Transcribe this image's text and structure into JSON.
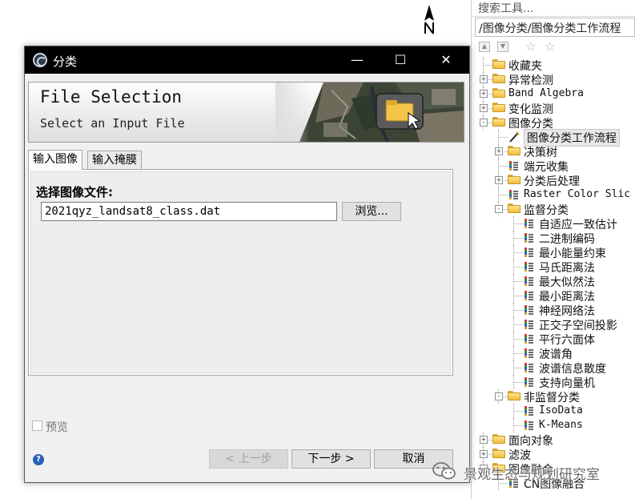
{
  "toolbox": {
    "search_placeholder": "搜索工具...",
    "path": "/图像分类/图像分类工作流程",
    "tree": [
      {
        "label": "收藏夹",
        "type": "folder",
        "depth": 0,
        "expander": ""
      },
      {
        "label": "异常检测",
        "type": "folder",
        "depth": 0,
        "expander": "+"
      },
      {
        "label": "Band Algebra",
        "type": "folder",
        "depth": 0,
        "expander": "+",
        "mono": true
      },
      {
        "label": "变化监测",
        "type": "folder",
        "depth": 0,
        "expander": "+"
      },
      {
        "label": "图像分类",
        "type": "folder",
        "depth": 0,
        "expander": "-"
      },
      {
        "label": "图像分类工作流程",
        "type": "wand",
        "depth": 1,
        "expander": "",
        "selected": true
      },
      {
        "label": "决策树",
        "type": "folder",
        "depth": 1,
        "expander": "+"
      },
      {
        "label": "端元收集",
        "type": "tool",
        "depth": 1,
        "expander": ""
      },
      {
        "label": "分类后处理",
        "type": "folder",
        "depth": 1,
        "expander": "+"
      },
      {
        "label": "Raster Color Slic",
        "type": "tool",
        "depth": 1,
        "expander": "",
        "mono": true
      },
      {
        "label": "监督分类",
        "type": "folder",
        "depth": 1,
        "expander": "-"
      },
      {
        "label": "自适应一致估计",
        "type": "tool",
        "depth": 2,
        "expander": ""
      },
      {
        "label": "二进制编码",
        "type": "tool",
        "depth": 2,
        "expander": ""
      },
      {
        "label": "最小能量约束",
        "type": "tool",
        "depth": 2,
        "expander": ""
      },
      {
        "label": "马氏距离法",
        "type": "tool",
        "depth": 2,
        "expander": ""
      },
      {
        "label": "最大似然法",
        "type": "tool",
        "depth": 2,
        "expander": ""
      },
      {
        "label": "最小距离法",
        "type": "tool",
        "depth": 2,
        "expander": ""
      },
      {
        "label": "神经网络法",
        "type": "tool",
        "depth": 2,
        "expander": ""
      },
      {
        "label": "正交子空间投影",
        "type": "tool",
        "depth": 2,
        "expander": ""
      },
      {
        "label": "平行六面体",
        "type": "tool",
        "depth": 2,
        "expander": ""
      },
      {
        "label": "波谱角",
        "type": "tool",
        "depth": 2,
        "expander": ""
      },
      {
        "label": "波谱信息散度",
        "type": "tool",
        "depth": 2,
        "expander": ""
      },
      {
        "label": "支持向量机",
        "type": "tool",
        "depth": 2,
        "expander": ""
      },
      {
        "label": "非监督分类",
        "type": "folder",
        "depth": 1,
        "expander": "-"
      },
      {
        "label": "IsoData",
        "type": "tool",
        "depth": 2,
        "expander": "",
        "mono": true
      },
      {
        "label": "K-Means",
        "type": "tool",
        "depth": 2,
        "expander": "",
        "mono": true
      },
      {
        "label": "面向对象",
        "type": "folder",
        "depth": 0,
        "expander": "+"
      },
      {
        "label": "滤波",
        "type": "folder",
        "depth": 0,
        "expander": "+"
      },
      {
        "label": "图像融合",
        "type": "folder",
        "depth": 0,
        "expander": "-"
      },
      {
        "label": "CN图像融合",
        "type": "tool",
        "depth": 1,
        "expander": ""
      }
    ]
  },
  "dialog": {
    "title": "分类",
    "window_buttons": {
      "minimize": "—",
      "maximize": "☐",
      "close": "✕"
    },
    "banner": {
      "title": "File Selection",
      "subtitle": "Select an Input File"
    },
    "tabs": [
      {
        "label": "输入图像",
        "active": true
      },
      {
        "label": "输入掩膜",
        "active": false
      }
    ],
    "file_label": "选择图像文件:",
    "file_value": "2021qyz_landsat8_class.dat",
    "browse_label": "浏览...",
    "preview_label": "预览",
    "help_icon": "?",
    "buttons": {
      "back": "< 上一步",
      "next": "下一步 >",
      "cancel": "取消"
    }
  },
  "watermark": {
    "text": "景观生态与规划研究室"
  },
  "colors": {
    "titlebar": "#000000",
    "dialog_bg": "#f0f0f0",
    "folder": "#f2bc3c",
    "help": "#2a5fb8"
  }
}
